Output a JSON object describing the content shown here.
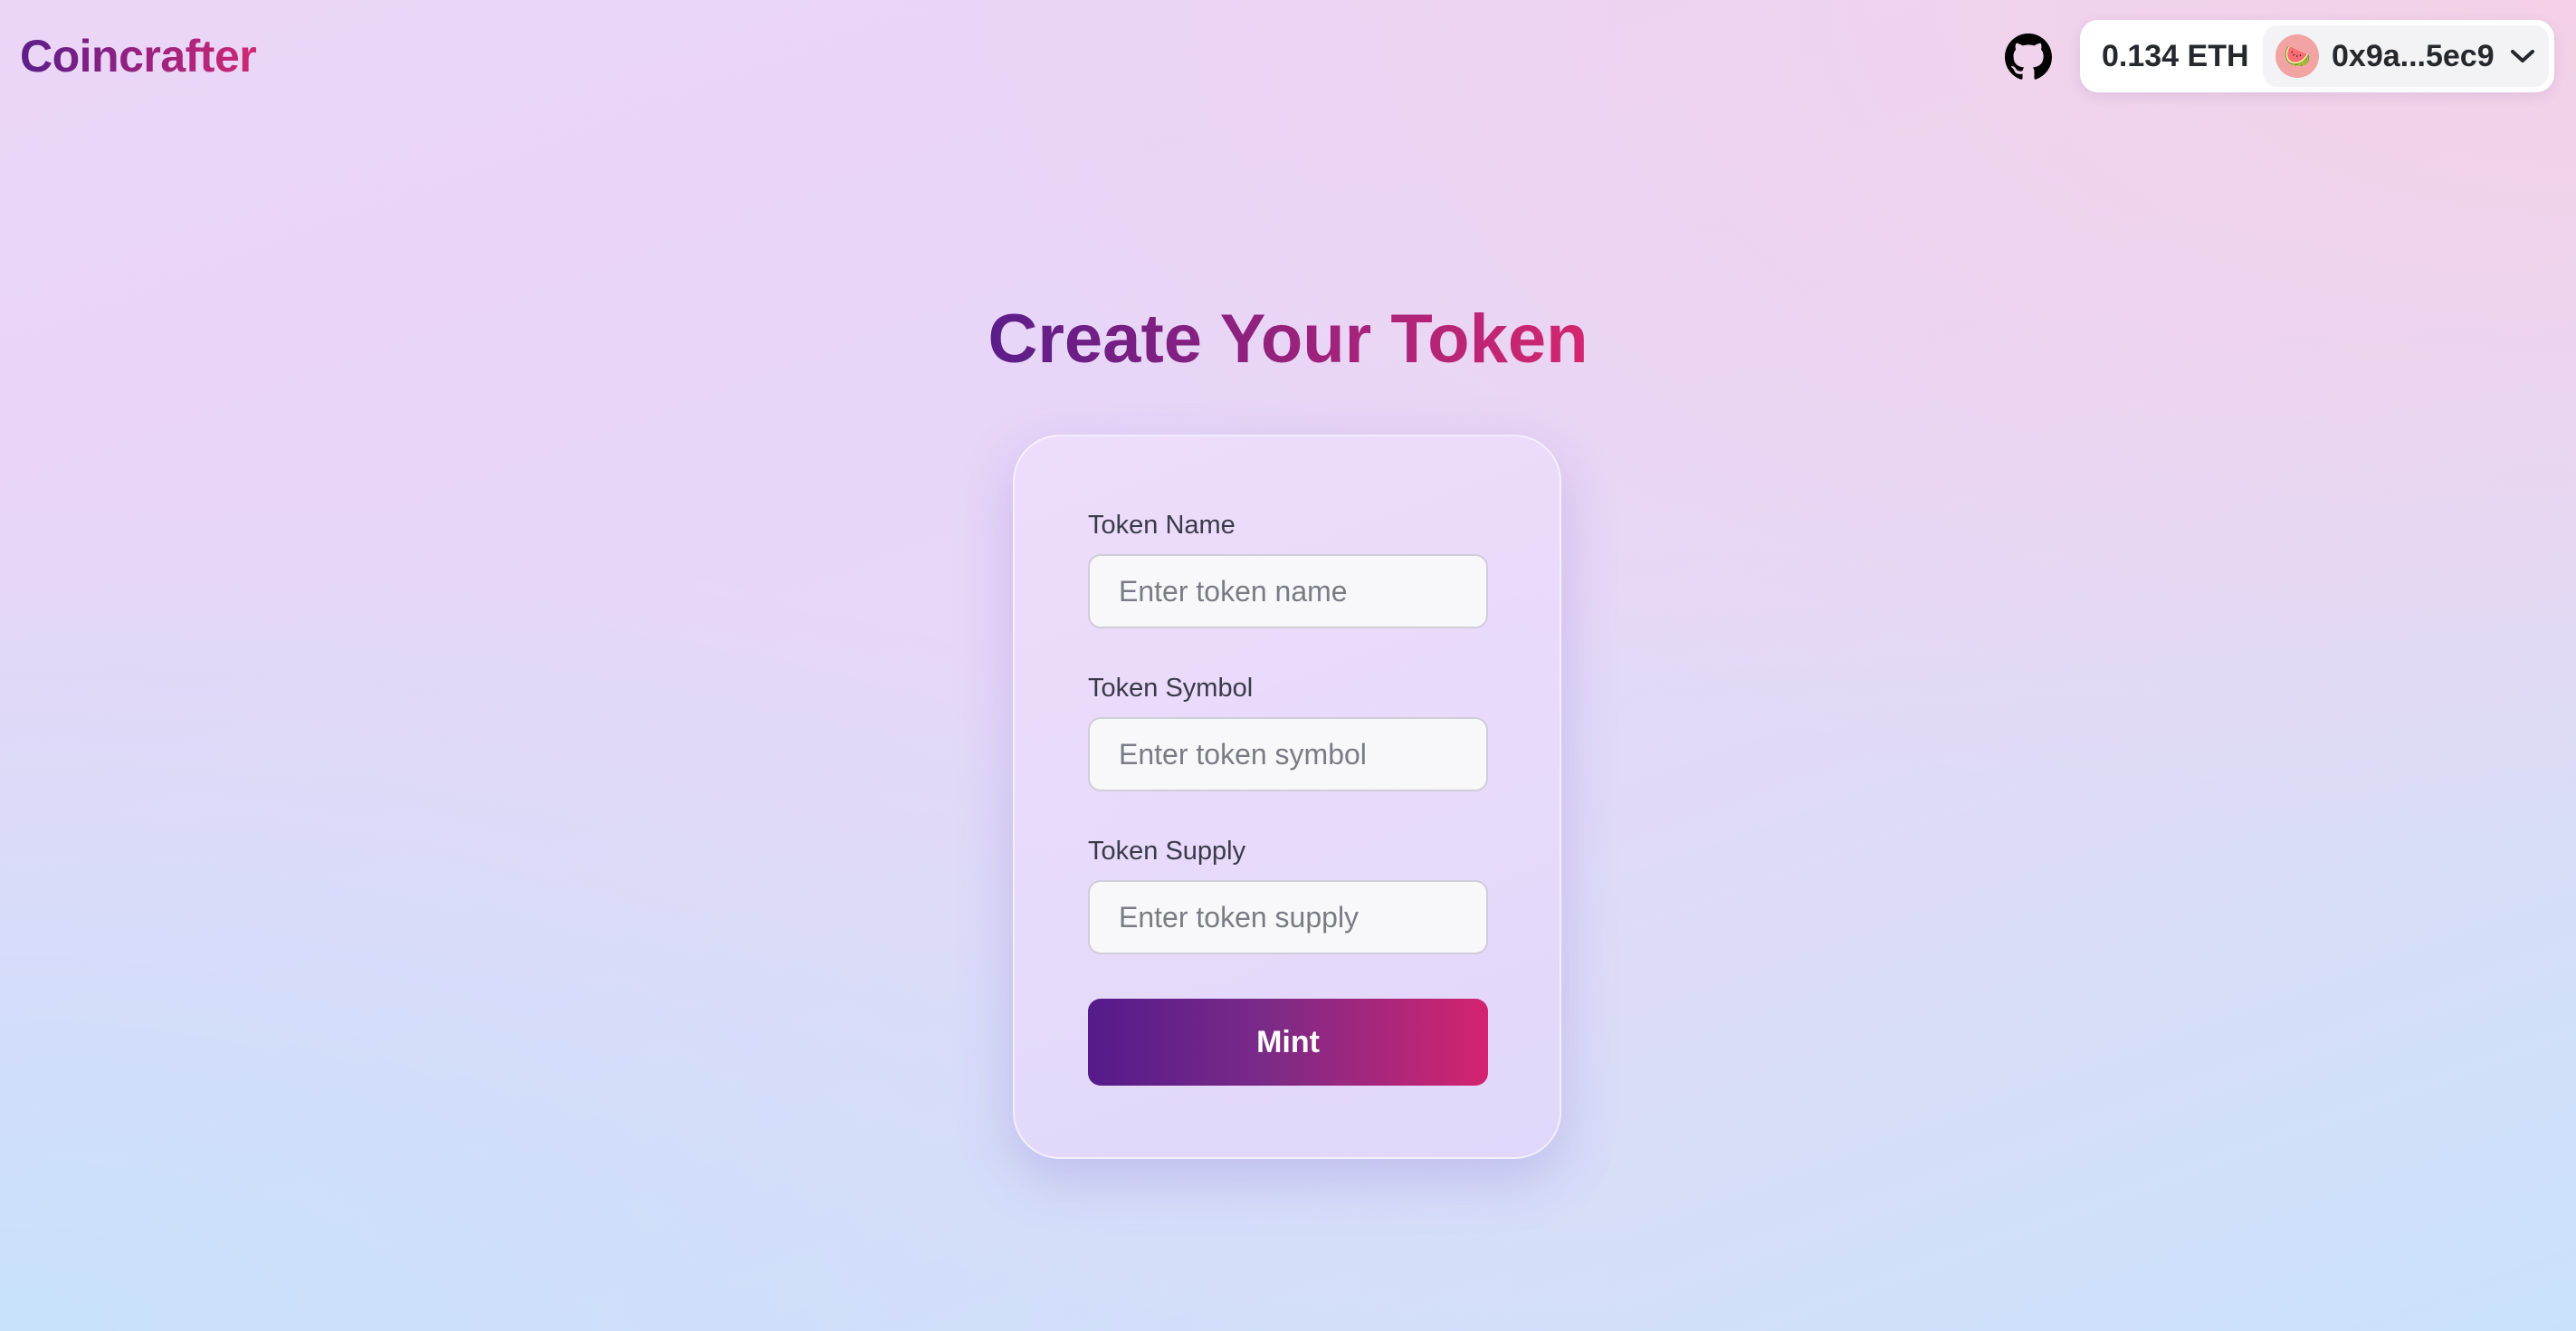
{
  "header": {
    "brand": "Coincrafter",
    "github_icon": "github-icon",
    "wallet": {
      "balance": "0.134 ETH",
      "address": "0x9a...5ec9",
      "avatar_icon": "avatar-icon",
      "dropdown_icon": "chevron-down-icon"
    }
  },
  "main": {
    "title": "Create Your Token",
    "form": {
      "fields": [
        {
          "label": "Token Name",
          "placeholder": "Enter token name",
          "value": ""
        },
        {
          "label": "Token Symbol",
          "placeholder": "Enter token symbol",
          "value": ""
        },
        {
          "label": "Token Supply",
          "placeholder": "Enter token supply",
          "value": ""
        }
      ],
      "submit_label": "Mint"
    }
  },
  "colors": {
    "accent_start": "#551a8b",
    "accent_end": "#d4236f",
    "background_top": "#ebd6f7",
    "background_bottom": "#c9e2fa"
  }
}
